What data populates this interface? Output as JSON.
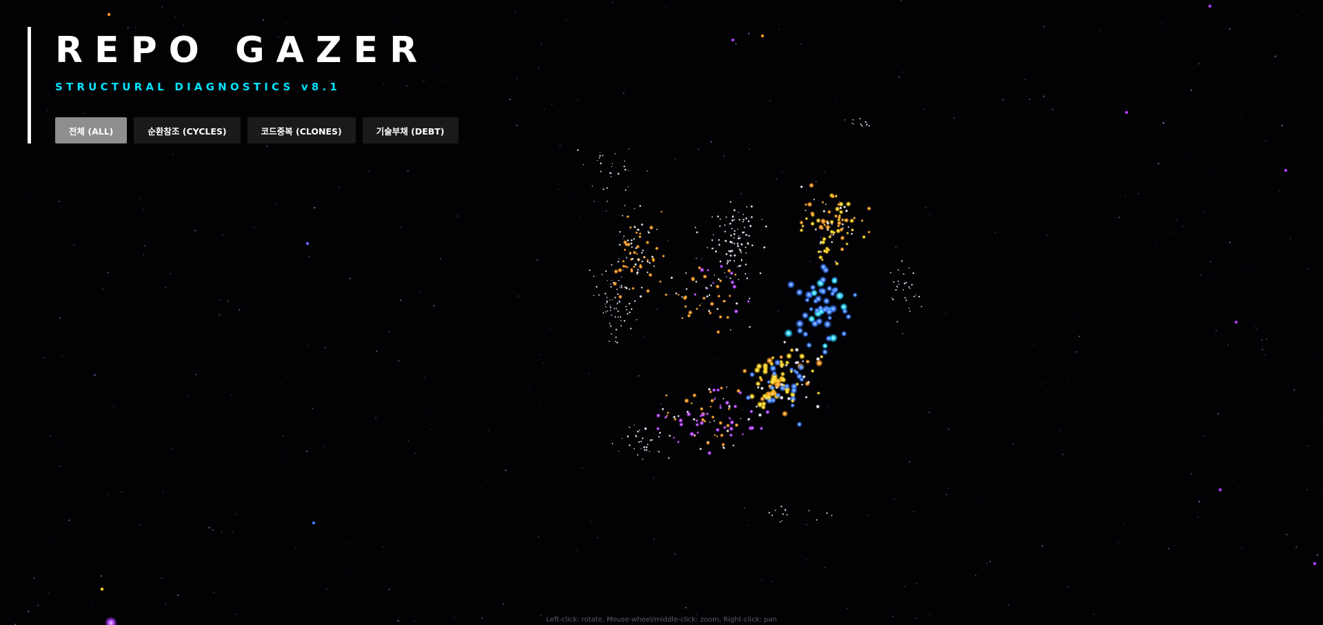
{
  "app": {
    "title": "REPO GAZER",
    "subtitle": "STRUCTURAL DIAGNOSTICS v8.1"
  },
  "filters": [
    {
      "label": "전체 (ALL)",
      "active": true
    },
    {
      "label": "순환참조 (CYCLES)",
      "active": false
    },
    {
      "label": "코드중복 (CLONES)",
      "active": false
    },
    {
      "label": "기술부채 (DEBT)",
      "active": false
    }
  ],
  "footer": {
    "hint": "Left-click: rotate, Mouse-wheel/middle-click: zoom, Right-click: pan"
  },
  "colors": {
    "background": "#020205",
    "title": "#ffffff",
    "subtitle": "#00e5ff",
    "button_bg": "#1a1a1c",
    "button_active_bg": "#8e8e8e",
    "node_white": "#e8e8f0",
    "node_orange": "#ff9a1f",
    "node_yellow": "#ffd21a",
    "node_blue": "#3a7bff",
    "node_cyan": "#29d6ff",
    "node_purple": "#b23cff"
  }
}
